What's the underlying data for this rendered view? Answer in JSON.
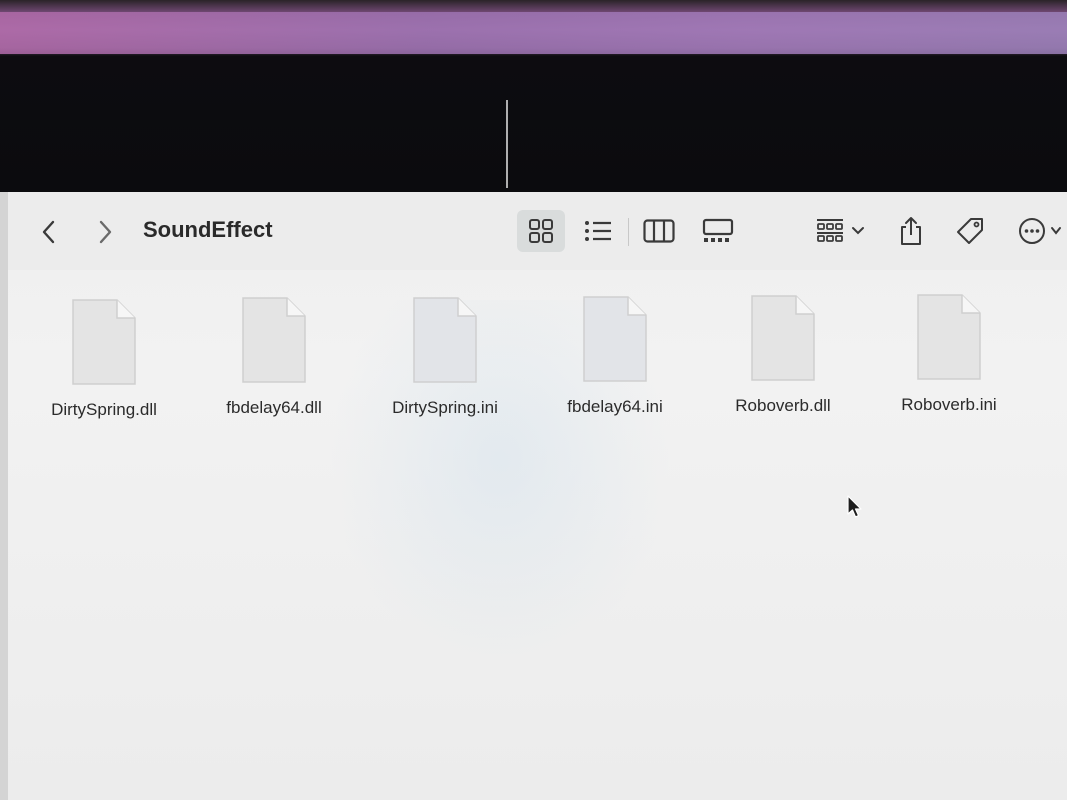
{
  "window": {
    "title": "SoundEffect"
  },
  "toolbar": {
    "back_icon": "chevron-left-icon",
    "forward_icon": "chevron-right-icon",
    "views": [
      {
        "name": "icon-view",
        "icon": "grid-icon",
        "active": true
      },
      {
        "name": "list-view",
        "icon": "list-icon",
        "active": false
      },
      {
        "name": "column-view",
        "icon": "columns-icon",
        "active": false
      },
      {
        "name": "gallery-view",
        "icon": "gallery-icon",
        "active": false
      }
    ],
    "group_icon": "group-icon",
    "share_icon": "share-icon",
    "tag_icon": "tag-icon",
    "more_icon": "ellipsis-circle-icon"
  },
  "files": [
    {
      "name": "DirtySpring.dll",
      "icon": "document-icon"
    },
    {
      "name": "fbdelay64.dll",
      "icon": "document-icon"
    },
    {
      "name": "DirtySpring.ini",
      "icon": "document-icon"
    },
    {
      "name": "fbdelay64.ini",
      "icon": "document-icon"
    },
    {
      "name": "Roboverb.dll",
      "icon": "document-icon"
    },
    {
      "name": "Roboverb.ini",
      "icon": "document-icon"
    }
  ],
  "colors": {
    "window_bg": "#efefef",
    "text": "#2a2a2a",
    "active_view_bg": "#d9dcdc"
  }
}
